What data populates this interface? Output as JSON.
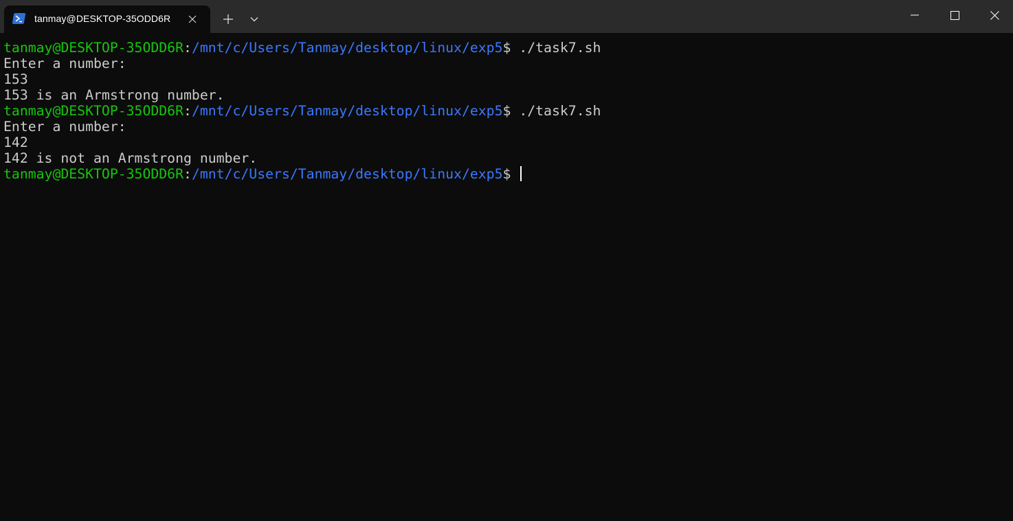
{
  "window": {
    "tab_title": "tanmay@DESKTOP-35ODD6R",
    "tab_icon": "powershell-icon",
    "controls": [
      "minimize-icon",
      "maximize-icon",
      "close-icon"
    ]
  },
  "colors": {
    "user_host": "#16c60c",
    "path": "#3b78ff",
    "text": "#cccccc",
    "background": "#0c0c0c",
    "titlebar": "#2b2b2b"
  },
  "terminal": {
    "prompt_user": "tanmay@DESKTOP-35ODD6R",
    "prompt_sep": ":",
    "prompt_path": "/mnt/c/Users/Tanmay/desktop/linux/exp5",
    "prompt_sym": "$",
    "lines": [
      {
        "type": "prompt",
        "command": " ./task7.sh"
      },
      {
        "type": "output",
        "text": "Enter a number:"
      },
      {
        "type": "output",
        "text": "153"
      },
      {
        "type": "output",
        "text": "153 is an Armstrong number."
      },
      {
        "type": "prompt",
        "command": " ./task7.sh"
      },
      {
        "type": "output",
        "text": "Enter a number:"
      },
      {
        "type": "output",
        "text": "142"
      },
      {
        "type": "output",
        "text": "142 is not an Armstrong number."
      },
      {
        "type": "prompt",
        "command": " "
      }
    ]
  }
}
